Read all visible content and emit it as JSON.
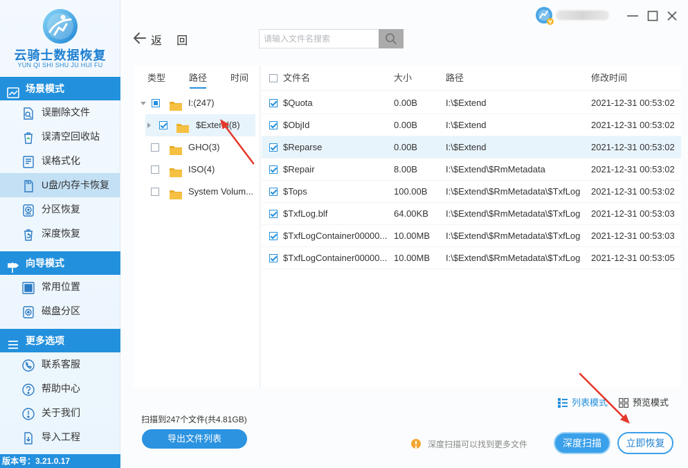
{
  "app": {
    "title": "云骑士数据恢复",
    "subtitle": "YUN QI SHI SHU JU HUI FU",
    "version": "版本号：3.21.0.17",
    "logo_icon": "knight-logo-icon"
  },
  "colors": {
    "accent": "#2390dd",
    "arrow": "#e5382c",
    "folder": "#f6c143",
    "warning": "#f3a635",
    "selected_row": "#e8f4fb",
    "sidebar_selected": "#c3e0f5",
    "sidebar_bg": "#eaf5fd"
  },
  "sidebar": {
    "sections": [
      {
        "title": "场景模式",
        "icon": "chart-icon",
        "items": [
          {
            "label": "误删除文件",
            "icon": "file-search-icon",
            "selected": false
          },
          {
            "label": "误清空回收站",
            "icon": "recycle-bin-icon",
            "selected": false
          },
          {
            "label": "误格式化",
            "icon": "format-drive-icon",
            "selected": false
          },
          {
            "label": "U盘/内存卡恢复",
            "icon": "usb-card-icon",
            "selected": true
          },
          {
            "label": "分区恢复",
            "icon": "partition-icon",
            "selected": false
          },
          {
            "label": "深度恢复",
            "icon": "deep-recovery-icon",
            "selected": false
          }
        ]
      },
      {
        "title": "向导模式",
        "icon": "signpost-icon",
        "items": [
          {
            "label": "常用位置",
            "icon": "windows-icon",
            "selected": false
          },
          {
            "label": "磁盘分区",
            "icon": "disk-icon",
            "selected": false
          }
        ]
      },
      {
        "title": "更多选项",
        "icon": "menu-icon",
        "items": [
          {
            "label": "联系客服",
            "icon": "phone-icon",
            "selected": false
          },
          {
            "label": "帮助中心",
            "icon": "help-icon",
            "selected": false
          },
          {
            "label": "关于我们",
            "icon": "info-icon",
            "selected": false
          },
          {
            "label": "导入工程",
            "icon": "import-icon",
            "selected": false
          }
        ]
      }
    ]
  },
  "window_controls": {
    "minimize": "minimize-icon",
    "maximize": "maximize-icon",
    "close": "close-icon"
  },
  "toolbar": {
    "back_label": "返 回",
    "search_placeholder": "请输入文件名搜索",
    "search_icon": "search-icon"
  },
  "tree": {
    "tabs": [
      {
        "label": "类型",
        "active": false
      },
      {
        "label": "路径",
        "active": true
      },
      {
        "label": "时间",
        "active": false
      }
    ],
    "nodes": [
      {
        "label": "I:(247)",
        "expanded": true,
        "check": "partial",
        "selected": false
      },
      {
        "label": "$Extend(8)",
        "expanded": false,
        "check": true,
        "selected": true
      },
      {
        "label": "GHO(3)",
        "check": false,
        "selected": false
      },
      {
        "label": "ISO(4)",
        "check": false,
        "selected": false
      },
      {
        "label": "System Volum...",
        "check": false,
        "selected": false
      }
    ]
  },
  "file_list": {
    "columns": [
      "文件名",
      "大小",
      "路径",
      "修改时间"
    ],
    "all_checked": false,
    "rows": [
      {
        "name": "$Quota",
        "size": "0.00B",
        "path": "I:\\$Extend",
        "modified": "2021-12-31 00:53:02",
        "checked": true,
        "selected": false
      },
      {
        "name": "$ObjId",
        "size": "0.00B",
        "path": "I:\\$Extend",
        "modified": "2021-12-31 00:53:02",
        "checked": true,
        "selected": false
      },
      {
        "name": "$Reparse",
        "size": "0.00B",
        "path": "I:\\$Extend",
        "modified": "2021-12-31 00:53:02",
        "checked": true,
        "selected": true
      },
      {
        "name": "$Repair",
        "size": "8.00B",
        "path": "I:\\$Extend\\$RmMetadata",
        "modified": "2021-12-31 00:53:02",
        "checked": true,
        "selected": false
      },
      {
        "name": "$Tops",
        "size": "100.00B",
        "path": "I:\\$Extend\\$RmMetadata\\$TxfLog",
        "modified": "2021-12-31 00:53:02",
        "checked": true,
        "selected": false
      },
      {
        "name": "$TxfLog.blf",
        "size": "64.00KB",
        "path": "I:\\$Extend\\$RmMetadata\\$TxfLog",
        "modified": "2021-12-31 00:53:03",
        "checked": true,
        "selected": false
      },
      {
        "name": "$TxfLogContainer00000...",
        "size": "10.00MB",
        "path": "I:\\$Extend\\$RmMetadata\\$TxfLog",
        "modified": "2021-12-31 00:53:03",
        "checked": true,
        "selected": false
      },
      {
        "name": "$TxfLogContainer00000...",
        "size": "10.00MB",
        "path": "I:\\$Extend\\$RmMetadata\\$TxfLog",
        "modified": "2021-12-31 00:53:05",
        "checked": true,
        "selected": false
      }
    ]
  },
  "footer": {
    "view_modes": [
      {
        "label": "列表模式",
        "icon": "list-view-icon",
        "active": true
      },
      {
        "label": "预览模式",
        "icon": "grid-view-icon",
        "active": false
      }
    ],
    "scan_summary": "扫描到247个文件(共4.81GB)",
    "export_button": "导出文件列表",
    "tip_icon": "warning-icon",
    "tip": "深度扫描可以找到更多文件",
    "deep_scan_button": "深度扫描",
    "recover_button": "立即恢复"
  }
}
